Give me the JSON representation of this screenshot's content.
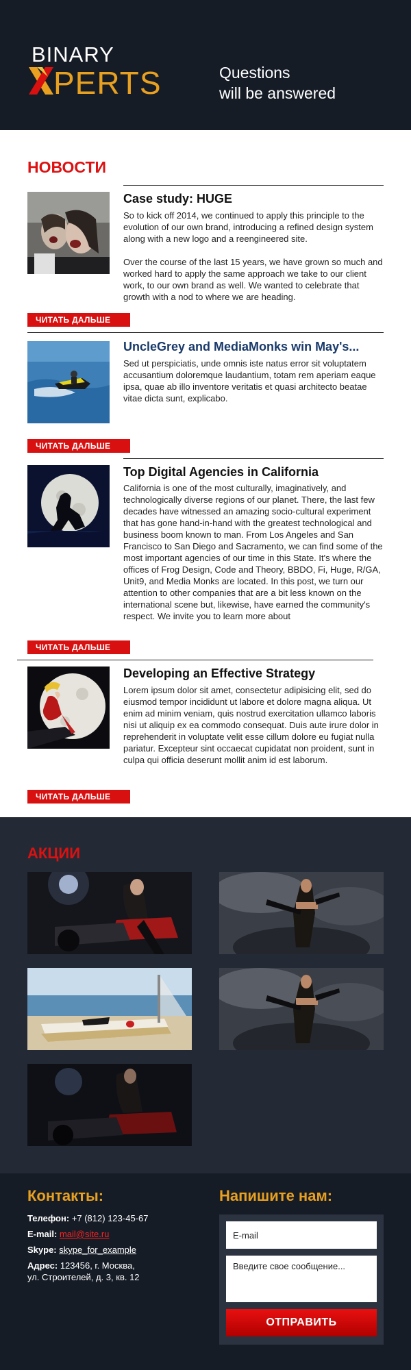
{
  "header": {
    "logo_top": "BINARY",
    "logo_bottom": "PERTS",
    "tagline_line1": "Questions",
    "tagline_line2": "will be answered",
    "bg_color": "#161c26",
    "accent_color": "#e8a020"
  },
  "news": {
    "title": "НОВОСТИ",
    "read_more_label": "ЧИТАТЬ ДАЛЬШЕ",
    "articles": [
      {
        "title": "Case study: HUGE",
        "paragraphs": [
          "So to kick off 2014, we continued to apply this principle to the evolution of our own brand, introducing a refined design system along with a new logo and a reengineered site.",
          "Over the course of the last 15 years, we have grown so much and worked hard to apply the same approach we take to our client work, to our own brand as well. We wanted to celebrate that growth with a nod to where we are heading."
        ],
        "image": "zombie-photo"
      },
      {
        "title": "UncleGrey and MediaMonks win May's...",
        "paragraphs": [
          "Sed ut perspiciatis, unde omnis iste natus error sit voluptatem accusantium doloremque laudantium, totam rem aperiam eaque ipsa, quae ab illo inventore veritatis et quasi architecto beatae vitae dicta sunt, explicabo."
        ],
        "image": "jetski-photo"
      },
      {
        "title": "Top Digital Agencies in California",
        "paragraphs": [
          "California is one of the most culturally, imaginatively, and technologically diverse regions of our planet. There, the last few decades have witnessed an amazing socio-cultural experiment that has gone hand-in-hand with the greatest technological and business boom known to man. From Los Angeles and San Francisco to San Diego and Sacramento, we can find some of the most important agencies of our time in this State. It's where the offices of Frog Design, Code and Theory, BBDO, Fi, Huge, R/GA, Unit9, and Media Monks are located. In this post, we turn our attention to other companies that are a bit less known on the international scene but, likewise, have earned the community's respect. We invite you to learn more about"
        ],
        "image": "moon-silhouette-photo"
      },
      {
        "title": "Developing an Effective Strategy",
        "paragraphs": [
          "Lorem ipsum dolor sit amet, consectetur adipisicing elit, sed do eiusmod tempor incididunt ut labore et dolore magna aliqua. Ut enim ad minim veniam, quis nostrud exercitation ullamco laboris nisi ut aliquip ex ea commodo consequat. Duis aute irure dolor in reprehenderit in voluptate velit esse cillum dolore eu fugiat nulla pariatur. Excepteur sint occaecat cupidatat non proident, sunt in culpa qui officia deserunt mollit anim id est laborum."
        ],
        "image": "moon-woman-photo"
      }
    ]
  },
  "promos": {
    "title": "АКЦИИ",
    "items": [
      "motorcycle-woman-photo",
      "armed-woman-photo",
      "boat-beach-photo",
      "armed-woman-photo",
      "motorcycle-woman-dark-photo"
    ]
  },
  "footer": {
    "contacts_title": "Контакты:",
    "phone_label": "Телефон:",
    "phone": "+7 (812) 123-45-67",
    "email_label": "E-mail:",
    "email": "mail@site.ru",
    "skype_label": "Skype:",
    "skype": "skype_for_example",
    "address_label": "Адрес:",
    "address_line1": "123456, г. Москва,",
    "address_line2": "ул. Строителей, д. 3, кв. 12",
    "form_title": "Напишите нам:",
    "email_placeholder": "E-mail",
    "message_placeholder": "Введите свое сообщение...",
    "submit_label": "ОТПРАВИТЬ"
  }
}
